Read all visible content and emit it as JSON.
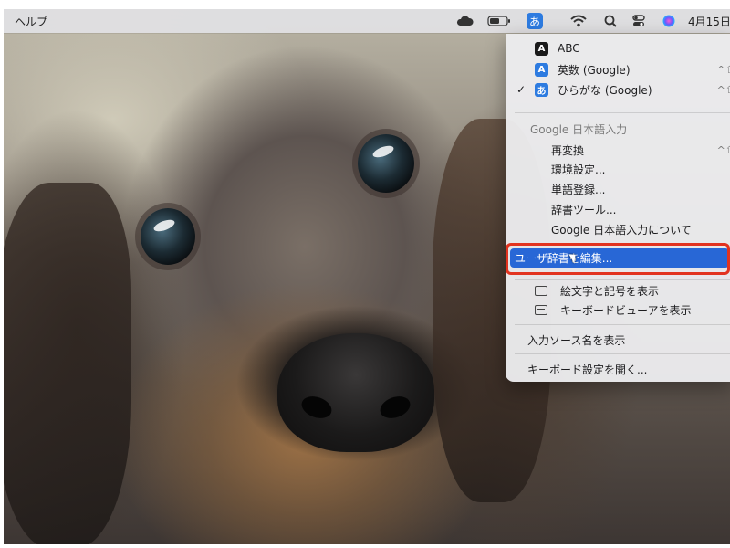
{
  "menubar": {
    "help": "ヘルプ",
    "input_indicator": "あ",
    "date": "4月15日",
    "icons": [
      "cloud-icon",
      "battery-icon",
      "input-source-icon",
      "wifi-icon",
      "search-icon",
      "control-center-icon",
      "siri-icon"
    ]
  },
  "menu": {
    "sources": [
      {
        "icon": "A",
        "label": "ABC",
        "checked": false,
        "shortcut": ""
      },
      {
        "icon": "A",
        "label": "英数 (Google)",
        "checked": false,
        "shortcut": "^⇧"
      },
      {
        "icon": "あ",
        "label": "ひらがな (Google)",
        "checked": true,
        "shortcut": "^⇧"
      }
    ],
    "checkmark": "✓",
    "section_title": "Google 日本語入力",
    "items": [
      {
        "label": "再変換",
        "shortcut": "^⇧"
      },
      {
        "label": "環境設定..."
      },
      {
        "label": "単語登録..."
      },
      {
        "label": "辞書ツール..."
      },
      {
        "label": "Google 日本語入力について"
      }
    ],
    "highlighted": "ユーザ辞書を編集...",
    "viewer_items": [
      {
        "label": "絵文字と記号を表示"
      },
      {
        "label": "キーボードビューアを表示"
      }
    ],
    "show_names": "入力ソース名を表示",
    "open_settings": "キーボード設定を開く..."
  },
  "colors": {
    "highlight": "#2867d6",
    "annotation": "#e2331f",
    "input_badge": "#2d7be0"
  }
}
